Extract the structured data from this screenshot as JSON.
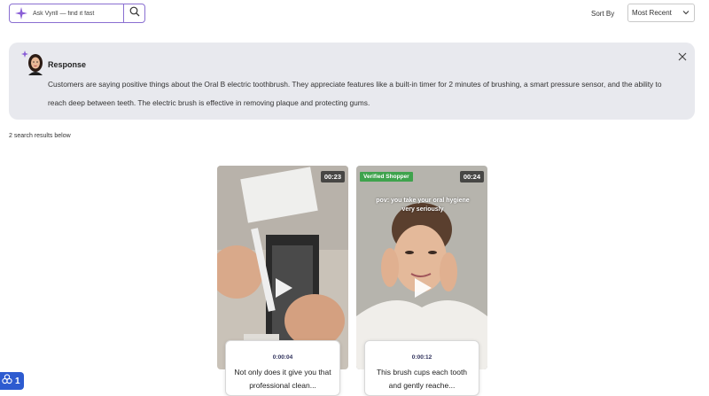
{
  "search": {
    "placeholder": "Ask Vyrill — find it fast"
  },
  "sort": {
    "label": "Sort By",
    "selected": "Most Recent"
  },
  "response": {
    "title": "Response",
    "text": "Customers are saying positive things about the Oral B electric toothbrush. They appreciate features like a built-in timer for 2 minutes of brushing, a smart pressure sensor, and the ability to reach deep between teeth. The electric brush is effective in removing plaque and protecting gums."
  },
  "results": {
    "count_text": "2 search results below"
  },
  "videos": [
    {
      "duration": "00:23",
      "timestamp": "0:00:04",
      "caption": "Not only does it give you that professional clean..."
    },
    {
      "duration": "00:24",
      "badge": "Verified Shopper",
      "overlay": "pov: you take your oral hygiene very seriously",
      "timestamp": "0:00:12",
      "caption": "This brush cups each tooth and gently reache..."
    }
  ],
  "fab": {
    "count": "1"
  },
  "colors": {
    "accent": "#8a6fd1",
    "response_bg": "#e8e9ee",
    "badge": "#3fa34d",
    "fab": "#2d5bd0"
  }
}
